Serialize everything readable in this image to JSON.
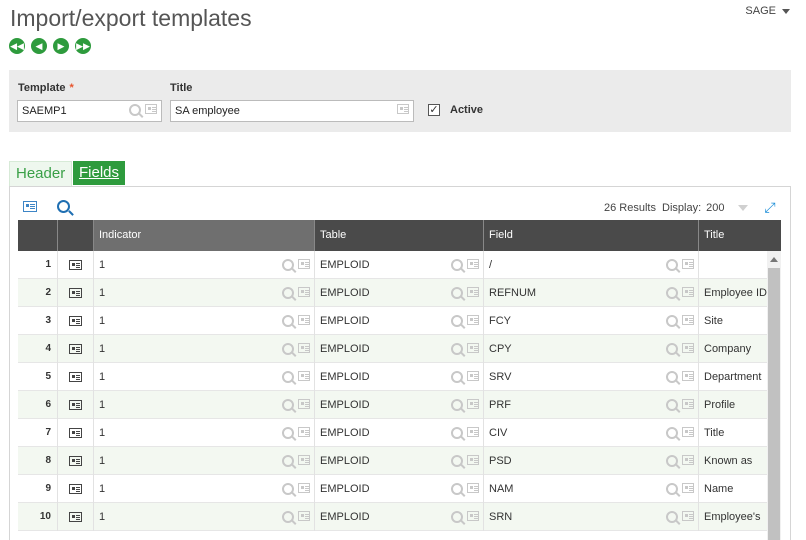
{
  "page_title": "Import/export templates",
  "user_menu": "SAGE",
  "nav": [
    "first-record",
    "previous-record",
    "next-record",
    "last-record"
  ],
  "form": {
    "template_label": "Template",
    "template_value": "SAEMP1",
    "title_label": "Title",
    "title_value": "SA employee",
    "active_label": "Active",
    "active_checked": true
  },
  "tabs": [
    {
      "label": "Header",
      "active": false
    },
    {
      "label": "Fields",
      "active": true
    }
  ],
  "grid": {
    "results_text": "26 Results",
    "display_label": "Display:",
    "display_value": "200",
    "columns": [
      "",
      "",
      "Indicator",
      "Table",
      "Field",
      "Title"
    ],
    "rows": [
      {
        "num": "1",
        "indicator": "1",
        "table": "EMPLOID",
        "field": "/",
        "title": ""
      },
      {
        "num": "2",
        "indicator": "1",
        "table": "EMPLOID",
        "field": "REFNUM",
        "title": "Employee ID"
      },
      {
        "num": "3",
        "indicator": "1",
        "table": "EMPLOID",
        "field": "FCY",
        "title": "Site"
      },
      {
        "num": "4",
        "indicator": "1",
        "table": "EMPLOID",
        "field": "CPY",
        "title": "Company"
      },
      {
        "num": "5",
        "indicator": "1",
        "table": "EMPLOID",
        "field": "SRV",
        "title": "Department"
      },
      {
        "num": "6",
        "indicator": "1",
        "table": "EMPLOID",
        "field": "PRF",
        "title": "Profile"
      },
      {
        "num": "7",
        "indicator": "1",
        "table": "EMPLOID",
        "field": "CIV",
        "title": "Title"
      },
      {
        "num": "8",
        "indicator": "1",
        "table": "EMPLOID",
        "field": "PSD",
        "title": "Known as"
      },
      {
        "num": "9",
        "indicator": "1",
        "table": "EMPLOID",
        "field": "NAM",
        "title": "Name"
      },
      {
        "num": "10",
        "indicator": "1",
        "table": "EMPLOID",
        "field": "SRN",
        "title": "Employee's"
      }
    ]
  },
  "colors": {
    "accent_green": "#2e9b3d",
    "header_dark": "#4a4a4a",
    "header_indicator": "#6f6f6f",
    "icon_blue": "#1f6fb2"
  }
}
